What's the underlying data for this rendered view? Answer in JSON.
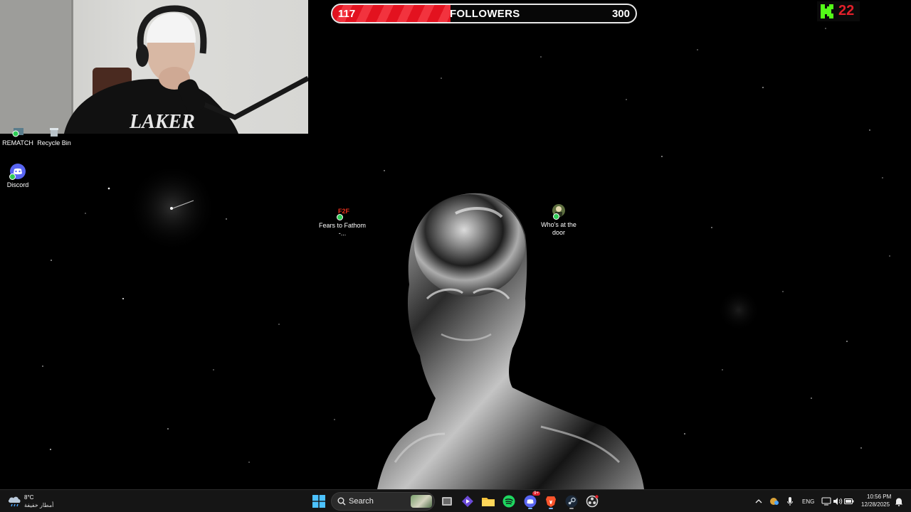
{
  "overlay": {
    "followers": {
      "current": "117",
      "label": "FOLLOWERS",
      "goal": "300",
      "progress_fraction": 0.39
    },
    "kick": {
      "icon": "kick-logo-icon",
      "count": "22"
    }
  },
  "desktop": {
    "icons": [
      {
        "id": "rematch",
        "label": "REMATCH",
        "icon": "rematch-game-icon"
      },
      {
        "id": "recycle",
        "label": "Recycle Bin",
        "icon": "recycle-bin-icon"
      },
      {
        "id": "discord",
        "label": "Discord",
        "icon": "discord-icon"
      },
      {
        "id": "fears",
        "label": "Fears to Fathom -...",
        "icon": "fears-to-fathom-icon",
        "badge_text": "F2F"
      },
      {
        "id": "whos",
        "label": "Who's at the door",
        "icon": "whos-at-the-door-icon"
      }
    ]
  },
  "taskbar": {
    "weather": {
      "temp": "8°C",
      "desc": "أمطار خفيفة",
      "icon": "weather-rain-cloud-icon"
    },
    "search": {
      "label": "Search"
    },
    "apps": [
      {
        "name": "start",
        "icon": "windows-start-icon"
      },
      {
        "name": "task-view",
        "icon": "task-view-icon"
      },
      {
        "name": "codex",
        "icon": "diamond-app-icon"
      },
      {
        "name": "file-explorer",
        "icon": "folder-icon"
      },
      {
        "name": "spotify",
        "icon": "spotify-icon"
      },
      {
        "name": "discord",
        "icon": "discord-icon",
        "badge": "9+"
      },
      {
        "name": "brave",
        "icon": "brave-browser-icon"
      },
      {
        "name": "steam",
        "icon": "steam-icon"
      },
      {
        "name": "obs",
        "icon": "obs-record-icon"
      }
    ],
    "tray": {
      "language": "ENG",
      "time": "10:56 PM",
      "date": "12/28/2025"
    }
  },
  "colors": {
    "follower_fill": "#e3121f",
    "kick_green": "#53fc18",
    "kick_red": "#e0202a",
    "taskbar_bg": "#151515"
  }
}
